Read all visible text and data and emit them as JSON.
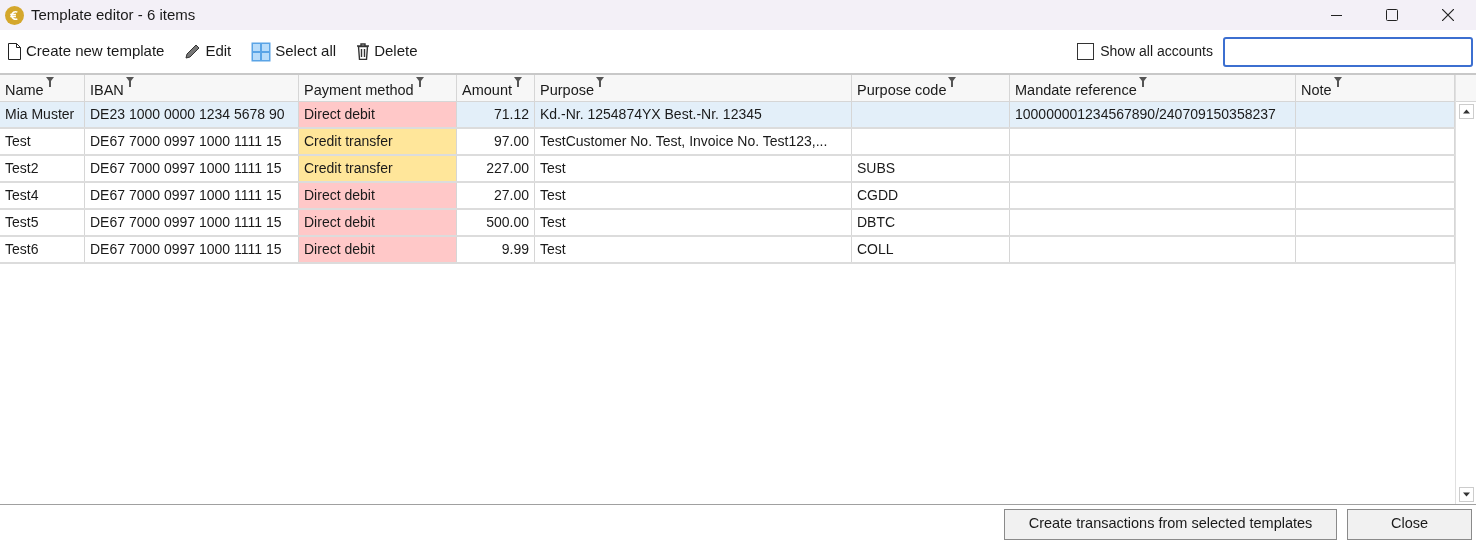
{
  "window": {
    "title": "Template editor - 6 items"
  },
  "toolbar": [
    {
      "kind": "new",
      "label": "Create new template"
    },
    {
      "kind": "edit",
      "label": "Edit"
    },
    {
      "kind": "select_all",
      "label": "Select all"
    },
    {
      "kind": "delete",
      "label": "Delete"
    }
  ],
  "show_all_accounts": {
    "label": "Show all accounts",
    "checked": false
  },
  "table": {
    "columns": [
      "Name",
      "IBAN",
      "Payment method",
      "Amount",
      "Purpose",
      "Purpose code",
      "Mandate reference",
      "Note"
    ],
    "rows": [
      {
        "selected": true,
        "cells": [
          "Mia Muster",
          "DE23 1000 0000 1234 5678 90",
          "Direct debit",
          "71.12",
          "Kd.-Nr. 1254874YX Best.-Nr. 12345",
          "",
          "100000001234567890/240709150358237",
          ""
        ],
        "color": "#ffc8c8"
      },
      {
        "selected": false,
        "cells": [
          "Test",
          "DE67 7000 0997 1000 1111 15",
          "Credit transfer",
          "97.00",
          "TestCustomer No. Test, Invoice No. Test123,...",
          "",
          "",
          ""
        ],
        "color": "#ffe69a"
      },
      {
        "selected": false,
        "cells": [
          "Test2",
          "DE67 7000 0997 1000 1111 15",
          "Credit transfer",
          "227.00",
          "Test",
          "SUBS",
          "",
          ""
        ],
        "color": "#ffe69a"
      },
      {
        "selected": false,
        "cells": [
          "Test4",
          "DE67 7000 0997 1000 1111 15",
          "Direct debit",
          "27.00",
          "Test",
          "CGDD",
          "",
          ""
        ],
        "color": "#ffc8c8"
      },
      {
        "selected": false,
        "cells": [
          "Test5",
          "DE67 7000 0997 1000 1111 15",
          "Direct debit",
          "500.00",
          "Test",
          "DBTC",
          "",
          ""
        ],
        "color": "#ffc8c8"
      },
      {
        "selected": false,
        "cells": [
          "Test6",
          "DE67 7000 0997 1000 1111 15",
          "Direct debit",
          "9.99",
          "Test",
          "COLL",
          "",
          ""
        ],
        "color": "#ffc8c8"
      }
    ]
  },
  "buttons": [
    "Create transactions from selected templates",
    "Close"
  ]
}
